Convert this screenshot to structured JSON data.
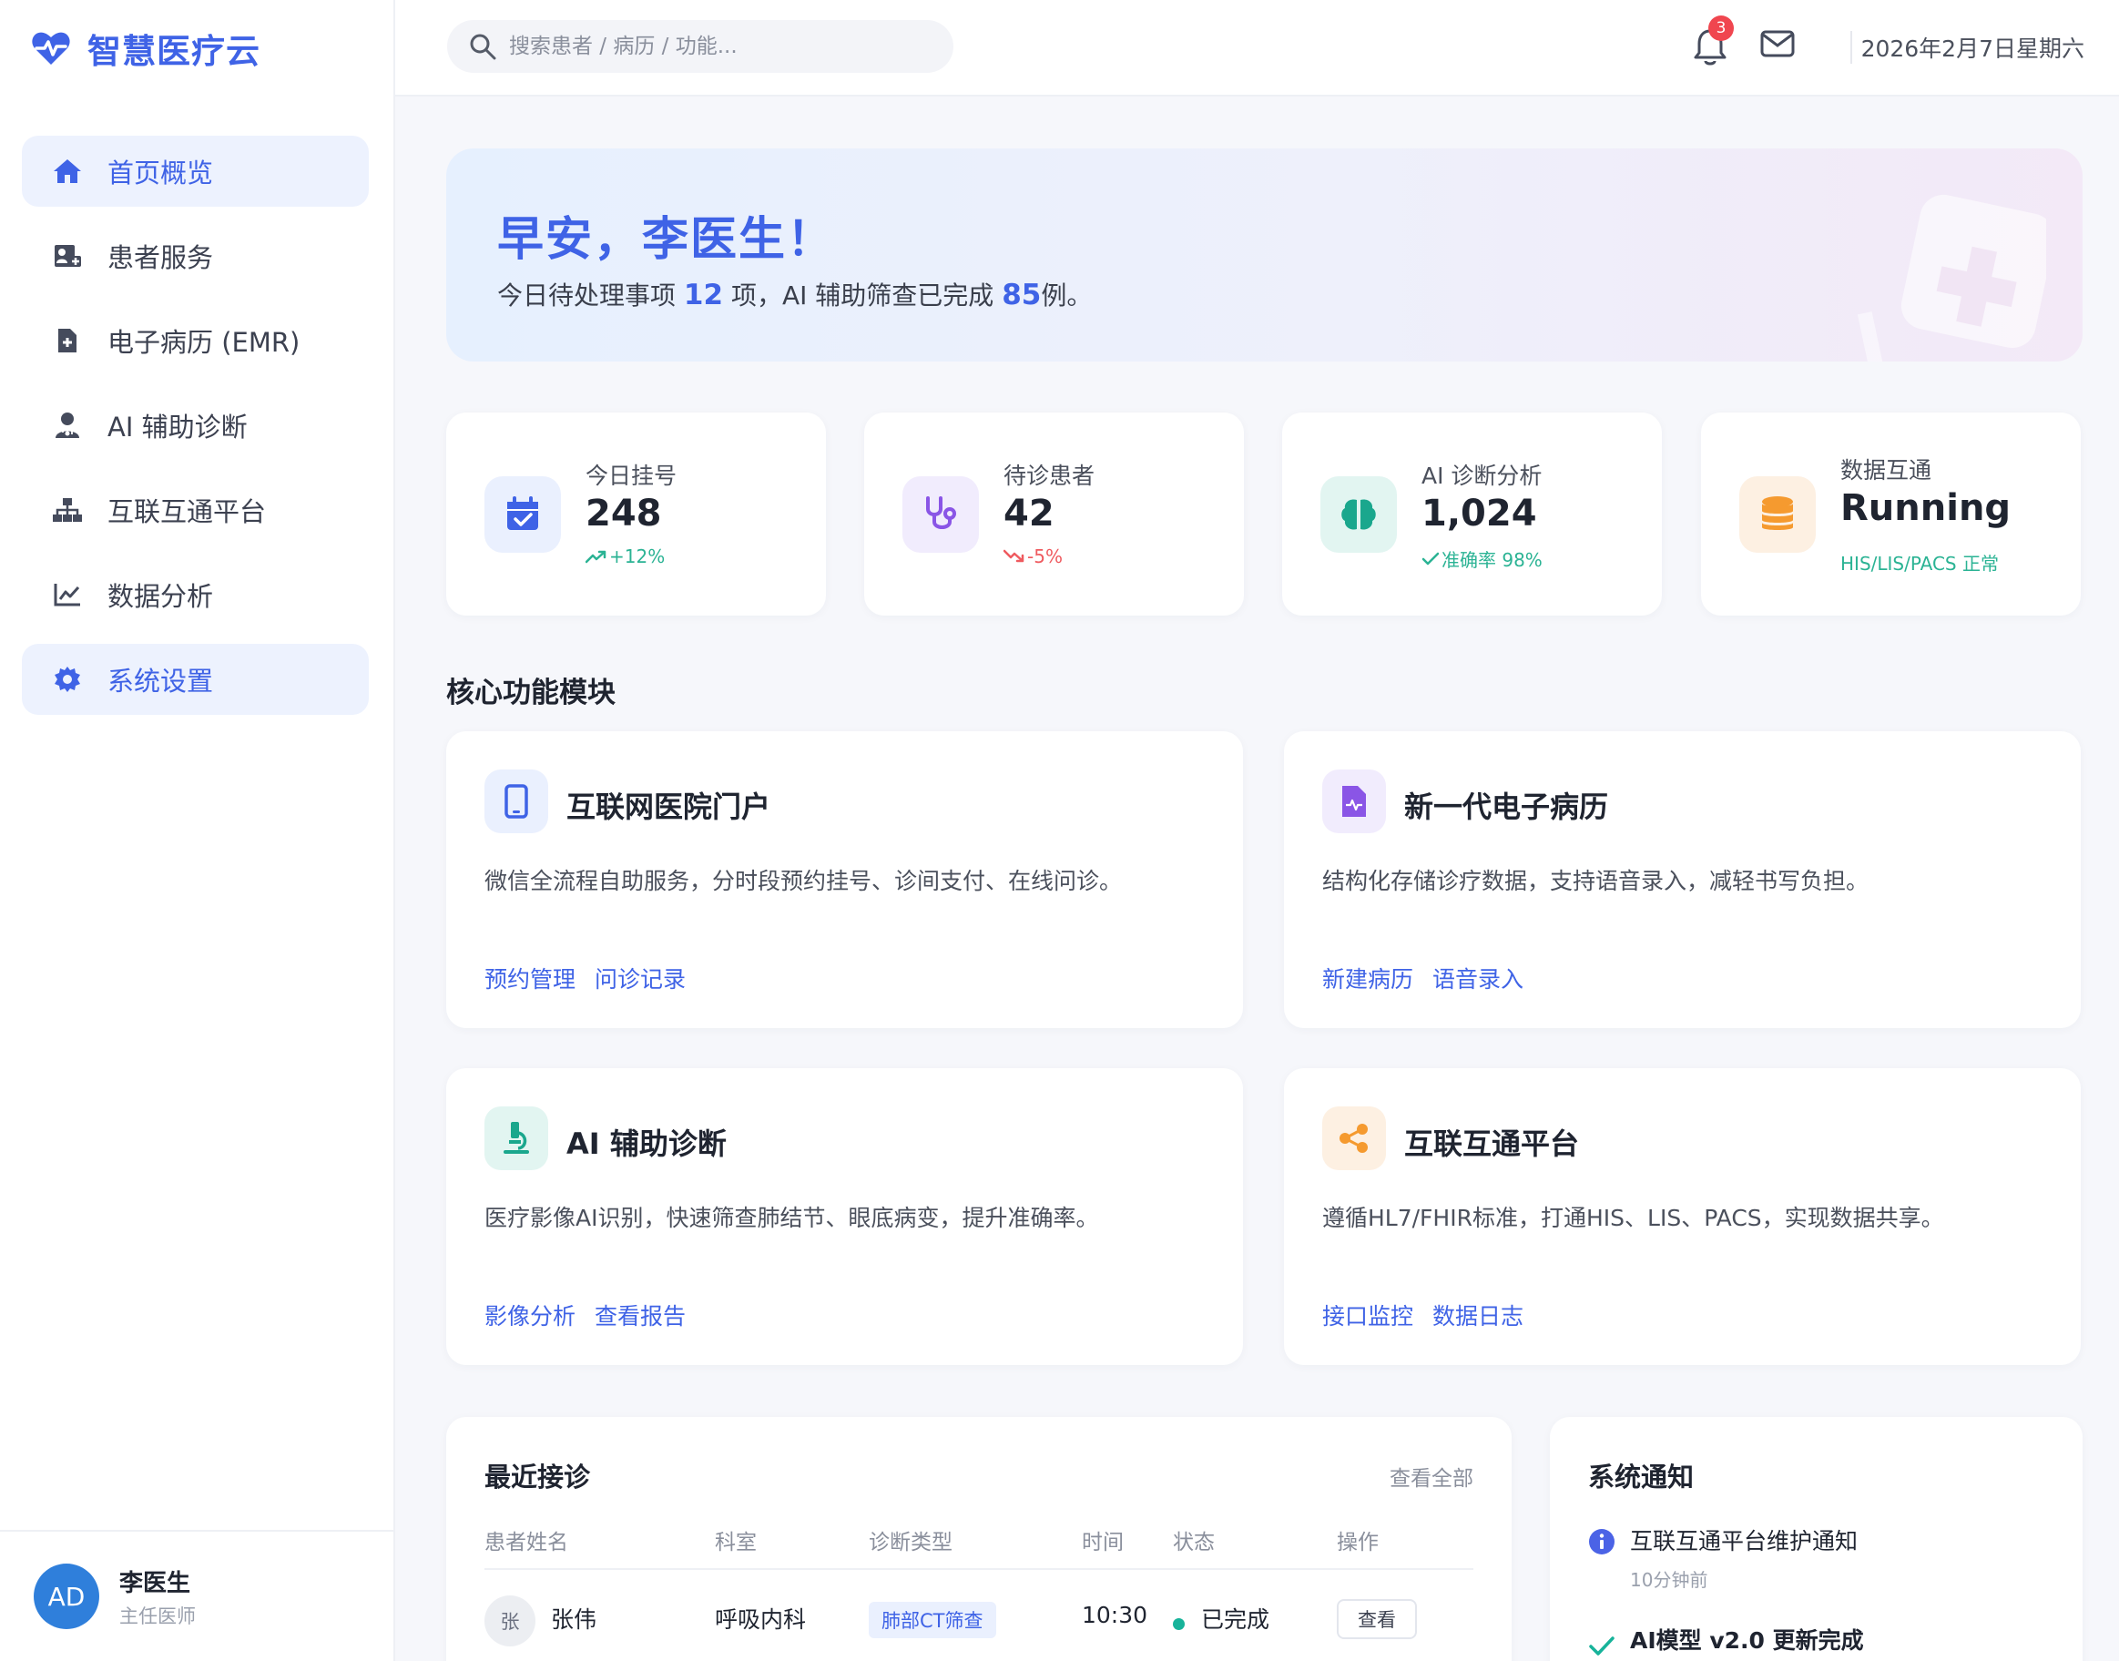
{
  "app": {
    "name": "智慧医疗云"
  },
  "colors": {
    "accent": "#3f63e6",
    "success": "#2bb394",
    "danger": "#ef5a5f",
    "badge": "#f0464f"
  },
  "sidebar": {
    "items": [
      {
        "label": "首页概览",
        "icon": "home-icon",
        "active": true
      },
      {
        "label": "患者服务",
        "icon": "patient-card-icon",
        "active": false
      },
      {
        "label": "电子病历 (EMR)",
        "icon": "medical-file-icon",
        "active": false
      },
      {
        "label": "AI 辅助诊断",
        "icon": "doctor-icon",
        "active": false
      },
      {
        "label": "互联互通平台",
        "icon": "network-icon",
        "active": false
      },
      {
        "label": "数据分析",
        "icon": "line-chart-icon",
        "active": false
      },
      {
        "label": "系统设置",
        "icon": "gear-icon",
        "active": true
      }
    ],
    "user": {
      "initials": "AD",
      "name": "李医生",
      "role": "主任医师"
    }
  },
  "topbar": {
    "search_placeholder": "搜索患者 / 病历 / 功能...",
    "notification_count": "3",
    "date": "2026年2月7日星期六"
  },
  "hero": {
    "title": "早安，李医生！",
    "sub_prefix": "今日待处理事项",
    "pending": "12",
    "sub_mid": "项，AI 辅助筛查已完成",
    "screened": "85",
    "sub_suffix": "例。"
  },
  "stats": [
    {
      "label": "今日挂号",
      "value": "248",
      "trend": "+12%",
      "icon": "calendar-check-icon"
    },
    {
      "label": "待诊患者",
      "value": "42",
      "trend": "-5%",
      "icon": "stethoscope-icon"
    },
    {
      "label": "AI 诊断分析",
      "value": "1,024",
      "trend": "准确率 98%",
      "icon": "brain-icon"
    },
    {
      "label": "数据互通",
      "value": "Running",
      "trend": "HIS/LIS/PACS 正常",
      "icon": "database-icon"
    }
  ],
  "modules_title": "核心功能模块",
  "modules": [
    {
      "title": "互联网医院门户",
      "desc": "微信全流程自助服务，分时段预约挂号、诊间支付、在线问诊。",
      "links": [
        "预约管理",
        "问诊记录"
      ],
      "icon": "mobile-icon"
    },
    {
      "title": "新一代电子病历",
      "desc": "结构化存储诊疗数据，支持语音录入，减轻书写负担。",
      "links": [
        "新建病历",
        "语音录入"
      ],
      "icon": "file-waveform-icon"
    },
    {
      "title": "AI 辅助诊断",
      "desc": "医疗影像AI识别，快速筛查肺结节、眼底病变，提升准确率。",
      "links": [
        "影像分析",
        "查看报告"
      ],
      "icon": "microscope-icon"
    },
    {
      "title": "互联互通平台",
      "desc": "遵循HL7/FHIR标准，打通HIS、LIS、PACS，实现数据共享。",
      "links": [
        "接口监控",
        "数据日志"
      ],
      "icon": "share-nodes-icon"
    }
  ],
  "recent": {
    "title": "最近接诊",
    "view_all": "查看全部",
    "columns": [
      "患者姓名",
      "科室",
      "诊断类型",
      "时间",
      "状态",
      "操作"
    ],
    "rows": [
      {
        "avatar": "张",
        "name": "张伟",
        "dept": "呼吸内科",
        "type": "肺部CT筛查",
        "time": "10:30",
        "status": "已完成",
        "action": "查看"
      }
    ]
  },
  "notices": {
    "title": "系统通知",
    "items": [
      {
        "title": "互联互通平台维护通知",
        "time": "10分钟前",
        "icon": "info-circle-icon"
      },
      {
        "title": "AI模型 v2.0 更新完成",
        "icon": "check-icon"
      }
    ]
  }
}
